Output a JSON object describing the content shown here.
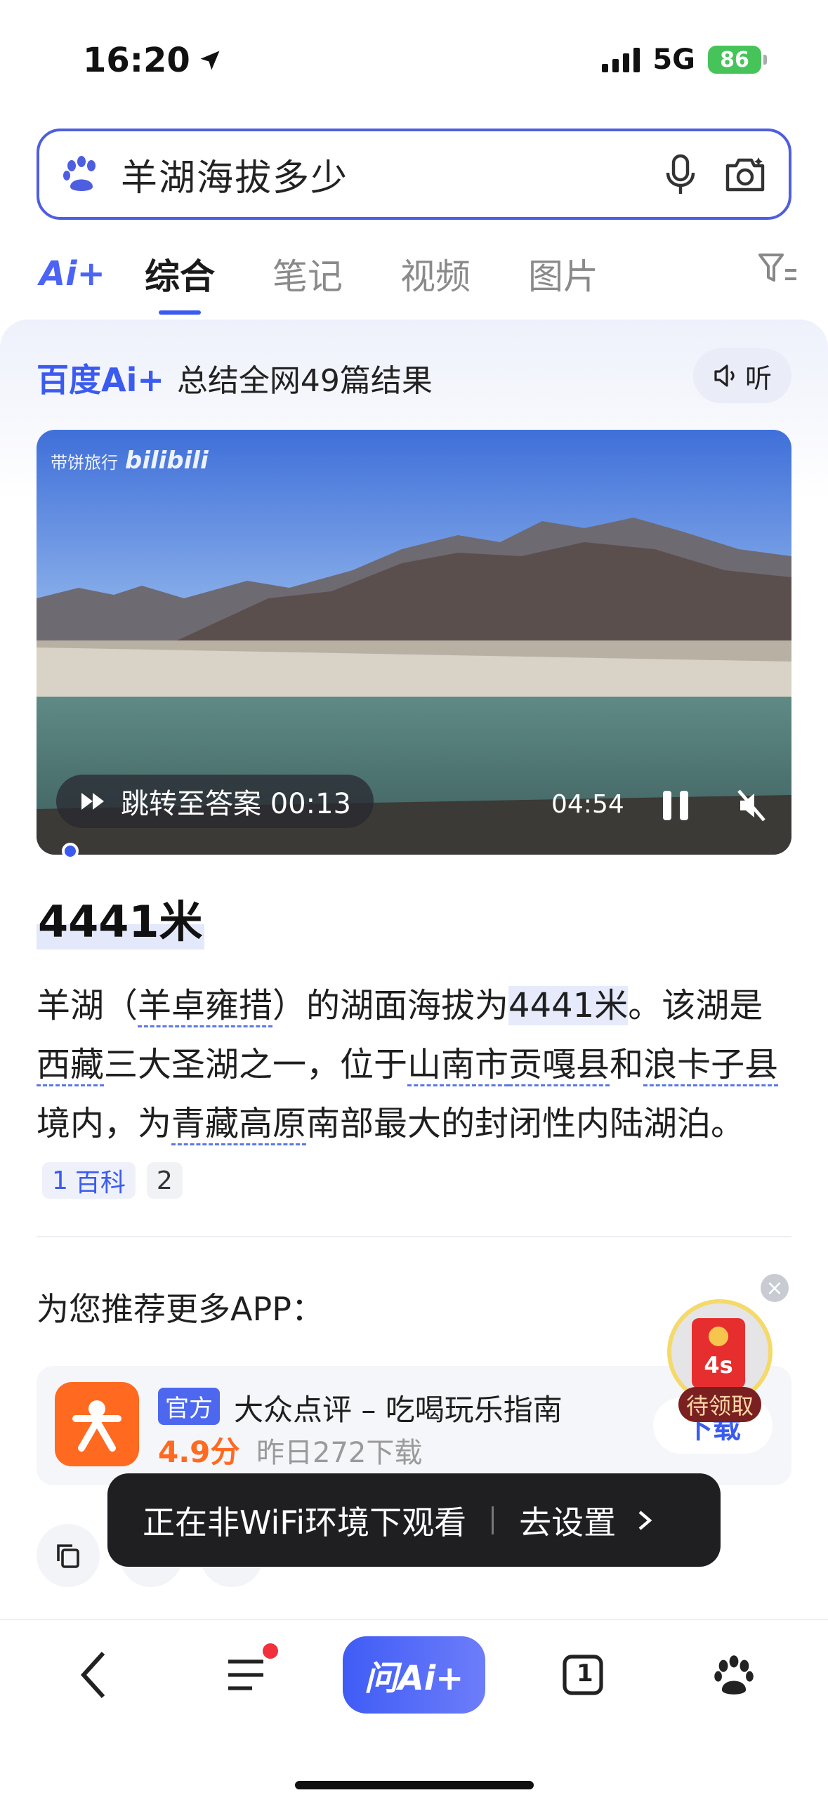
{
  "status_bar": {
    "time": "16:20",
    "network": "5G",
    "battery": "86"
  },
  "search": {
    "query": "羊湖海拔多少"
  },
  "tabs": {
    "ai_label": "Ai+",
    "items": [
      "综合",
      "笔记",
      "视频",
      "图片"
    ],
    "active": "综合"
  },
  "ai_card": {
    "brand": "百度Ai+",
    "summary": "总结全网49篇结果",
    "listen": "听",
    "video": {
      "watermark_channel": "带饼旅行",
      "watermark_site": "bilibili",
      "jump_label": "跳转至答案 00:13",
      "duration": "04:54"
    },
    "answer": "4441米",
    "paragraph": {
      "p1": "羊湖（",
      "p2": "羊卓雍措",
      "p3": "）的湖面海拔为",
      "p4": "4441米",
      "p5": "。该湖是",
      "p6": "西藏",
      "p7": "三大圣湖之一，位于",
      "p8": "山南市",
      "p9": "贡嘎县",
      "p10": "和",
      "p11": "浪卡子县",
      "p12": "境内，为",
      "p13": "青藏高原",
      "p14": "南部最大的封闭性内陆湖泊。"
    },
    "refs": [
      {
        "num": "1",
        "label": "百科"
      },
      {
        "num": "2",
        "label": ""
      }
    ]
  },
  "recommend": {
    "title": "为您推荐更多APP：",
    "app": {
      "badge": "官方",
      "name": "大众点评 – 吃喝玩乐指南",
      "rating": "4.9分",
      "downloads": "昨日272下载",
      "button": "下载"
    }
  },
  "float": {
    "timer": "4s",
    "label": "待领取",
    "close": "×"
  },
  "toast": {
    "text": "正在非WiFi环境下观看",
    "action": "去设置"
  },
  "bottom_nav": {
    "ask_ai": "问Ai+",
    "tabs_count": "1"
  }
}
